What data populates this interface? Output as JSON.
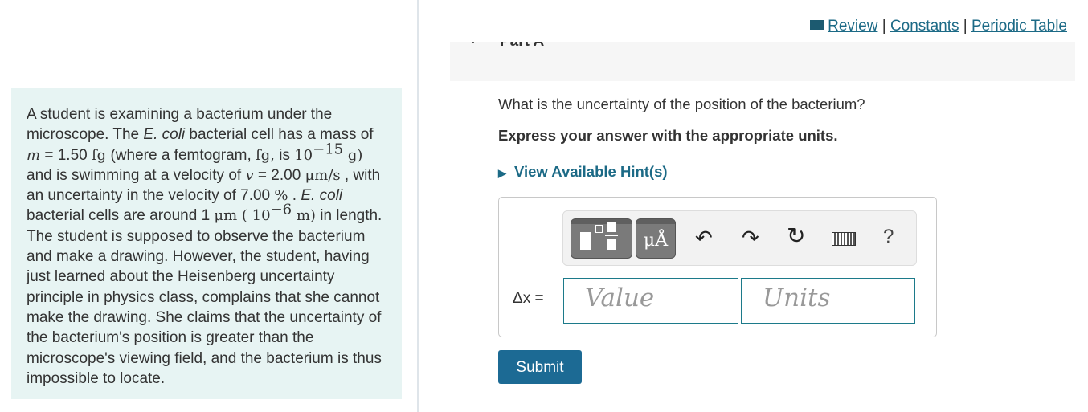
{
  "problem": {
    "s1": "A student is examining a bacterium under the microscope. The ",
    "s2": "E. coli",
    "s3": " bacterial cell has a mass of ",
    "m_var": "m",
    "s4": " = 1.50 ",
    "fg": "fg",
    "s5": " (where a femtogram, ",
    "fg2": "fg,",
    "s6": " is ",
    "ten": "10",
    "exp15": "−15",
    "g": " g)",
    "s7": " and is swimming at a velocity of ",
    "v_var": "v",
    "s8": " = 2.00 ",
    "ums": "μm/s",
    "s9": " , with an uncertainty in the velocity of 7.00 ",
    "pct": "%",
    "s10": " . ",
    "s11": "E. coli",
    "s12": " bacterial cells are around 1 ",
    "um": "μm",
    "paren": " ( 10",
    "exp6": "−6",
    "m_unit": " m)",
    "s13": " in length. The student is supposed to observe the bacterium and make a drawing. However, the student, having just learned about the Heisenberg uncertainty principle in physics class, complains that she cannot make the drawing. She claims that the uncertainty of the bacterium's position is greater than the microscope's viewing field, and the bacterium is thus impossible to locate."
  },
  "links": {
    "review": "Review",
    "sep": "|",
    "constants": "Constants",
    "periodic": "Periodic Table"
  },
  "part": {
    "title": "Part A"
  },
  "question": "What is the uncertainty of the position of the bacterium?",
  "instruction": "Express your answer with the appropriate units.",
  "hint": "View Available Hint(s)",
  "toolbar": {
    "units_btn": "μÅ",
    "help": "?"
  },
  "answer": {
    "label": "Δx =",
    "value_placeholder": "Value",
    "units_placeholder": "Units"
  },
  "submit": "Submit",
  "colors": {
    "accent": "#1c6a86",
    "submit": "#1c6a94",
    "panel": "#e7f4f3"
  }
}
